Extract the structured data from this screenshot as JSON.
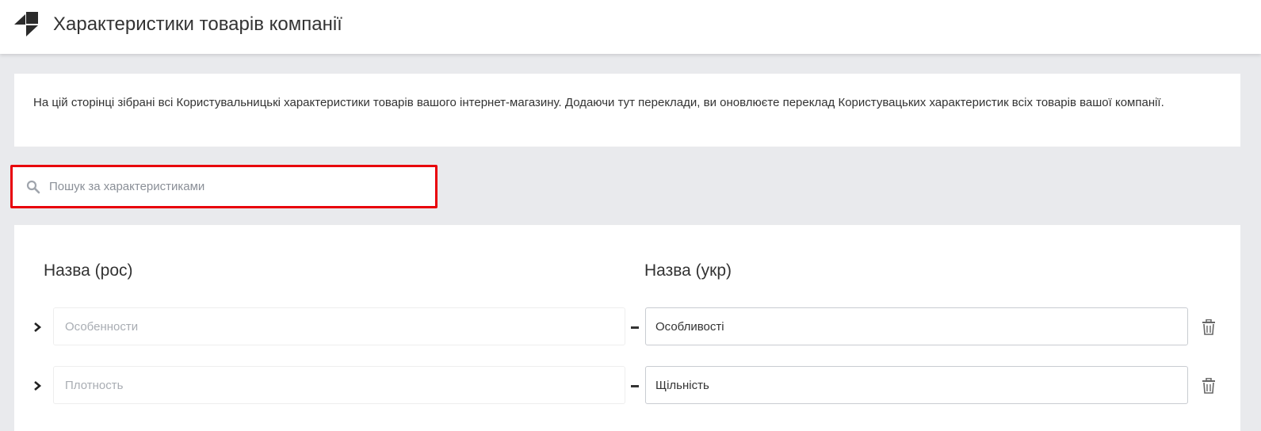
{
  "header": {
    "title": "Характеристики товарів компанії",
    "logo_icon": "stacked-squares-logo"
  },
  "info": {
    "text": "На цій сторінці зібрані всі Користувальницькі характеристики товарів вашого інтернет-магазину. Додаючи тут переклади, ви оновлюєте переклад Користувацьких характеристик всіх товарів вашої компанії."
  },
  "search": {
    "placeholder": "Пошук за характеристиками",
    "value": "",
    "highlight_color": "#e8000b"
  },
  "table": {
    "col_ru": "Назва (рос)",
    "col_uk": "Назва (укр)",
    "rows": [
      {
        "ru": "Особенности",
        "uk": "Особливості"
      },
      {
        "ru": "Плотность",
        "uk": "Щільність"
      }
    ]
  }
}
